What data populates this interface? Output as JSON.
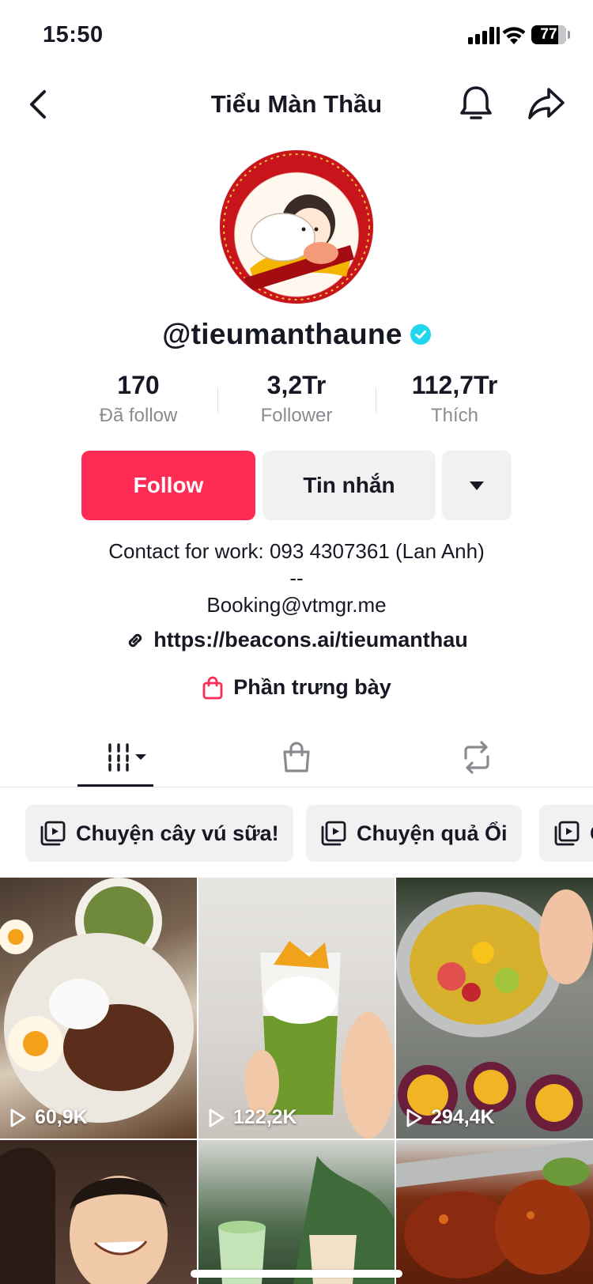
{
  "status_bar": {
    "time": "15:50",
    "battery": "77",
    "battery_level": 0.77
  },
  "header": {
    "title": "Tiểu Màn Thầu"
  },
  "profile": {
    "username": "@tieumanthaune",
    "verified": true,
    "stats": [
      {
        "value": "170",
        "label": "Đã follow"
      },
      {
        "value": "3,2Tr",
        "label": "Follower"
      },
      {
        "value": "112,7Tr",
        "label": "Thích"
      }
    ]
  },
  "actions": {
    "follow": "Follow",
    "message": "Tin nhắn"
  },
  "bio": {
    "lines": [
      "Contact for work: 093 4307361 (Lan Anh)",
      "--",
      "Booking@vtmgr.me"
    ],
    "link": "https://beacons.ai/tieumanthau",
    "showcase": "Phần trưng bày"
  },
  "playlists": [
    {
      "label": "Chuyện cây vú sữa!"
    },
    {
      "label": "Chuyện quả Ổi"
    },
    {
      "label": "C"
    }
  ],
  "videos": [
    {
      "views": "60,9K"
    },
    {
      "views": "122,2K"
    },
    {
      "views": "294,4K"
    },
    {
      "views": ""
    },
    {
      "views": ""
    },
    {
      "views": ""
    }
  ],
  "colors": {
    "accent": "#fe2c55",
    "verified": "#20d5ec",
    "text": "#161823",
    "muted": "#8a8b91",
    "button_bg": "#f1f1f2"
  }
}
